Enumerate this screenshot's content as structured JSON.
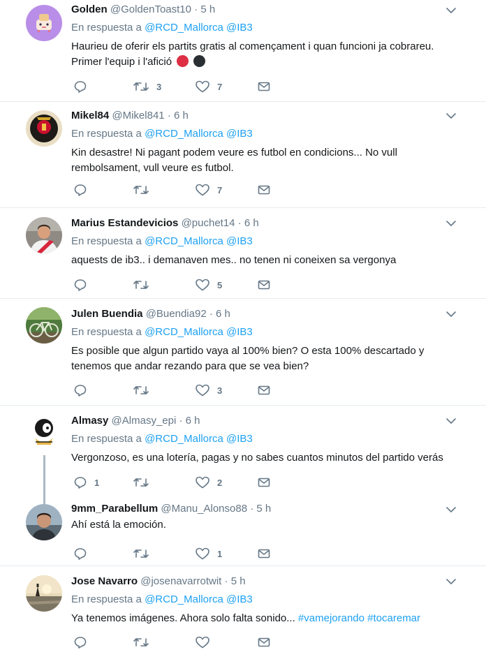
{
  "reply_prefix": "En respuesta a",
  "tweets": [
    {
      "name": "Golden",
      "handle": "@GoldenToast10",
      "time": "5 h",
      "reply_to": [
        "@RCD_Mallorca",
        "@IB3"
      ],
      "text": "Haurieu de oferir els partits gratis al començament i quan funcioni ja cobrareu. Primer l'equip i l'afició",
      "emoji": [
        "red-circle",
        "black-circle"
      ],
      "replies": "",
      "retweets": "3",
      "likes": "7",
      "avatar": "toaster-avatar"
    },
    {
      "name": "Mikel84",
      "handle": "@Mikel841",
      "time": "6 h",
      "reply_to": [
        "@RCD_Mallorca",
        "@IB3"
      ],
      "text": "Kin desastre! Ni pagant podem veure es futbol en condicions... No vull rembolsament, vull veure es futbol.",
      "replies": "",
      "retweets": "",
      "likes": "7",
      "avatar": "club-crest-avatar"
    },
    {
      "name": "Marius Estandevicios",
      "handle": "@puchet14",
      "time": "6 h",
      "reply_to": [
        "@RCD_Mallorca",
        "@IB3"
      ],
      "text": "aquests de ib3.. i demanaven mes.. no tenen ni coneixen sa vergonya",
      "replies": "",
      "retweets": "",
      "likes": "5",
      "avatar": "player-avatar"
    },
    {
      "name": "Julen Buendia",
      "handle": "@Buendia92",
      "time": "6 h",
      "reply_to": [
        "@RCD_Mallorca",
        "@IB3"
      ],
      "text": "Es posible que algun partido vaya al 100% bien? O esta 100% descartado y tenemos que andar rezando para que se vea bien?",
      "replies": "",
      "retweets": "",
      "likes": "3",
      "avatar": "bicycle-avatar"
    },
    {
      "name": "Almasy",
      "handle": "@Almasy_epi",
      "time": "6 h",
      "reply_to": [
        "@RCD_Mallorca",
        "@IB3"
      ],
      "text": "Vergonzoso, es una lotería, pagas y no sabes cuantos minutos del partido verás",
      "replies": "1",
      "retweets": "",
      "likes": "2",
      "avatar": "cartoon-avatar"
    },
    {
      "name": "9mm_Parabellum",
      "handle": "@Manu_Alonso88",
      "time": "5 h",
      "reply_to": [],
      "text": "Ahí está la emoción.",
      "replies": "",
      "retweets": "",
      "likes": "1",
      "avatar": "man-avatar"
    },
    {
      "name": "Jose Navarro",
      "handle": "@josenavarrotwit",
      "time": "5 h",
      "reply_to": [
        "@RCD_Mallorca",
        "@IB3"
      ],
      "text": "Ya tenemos imágenes. Ahora solo falta sonido...",
      "hashtags": [
        "#vamejorando",
        "#tocaremar"
      ],
      "replies": "",
      "retweets": "",
      "likes": "",
      "avatar": "sunset-avatar"
    }
  ]
}
